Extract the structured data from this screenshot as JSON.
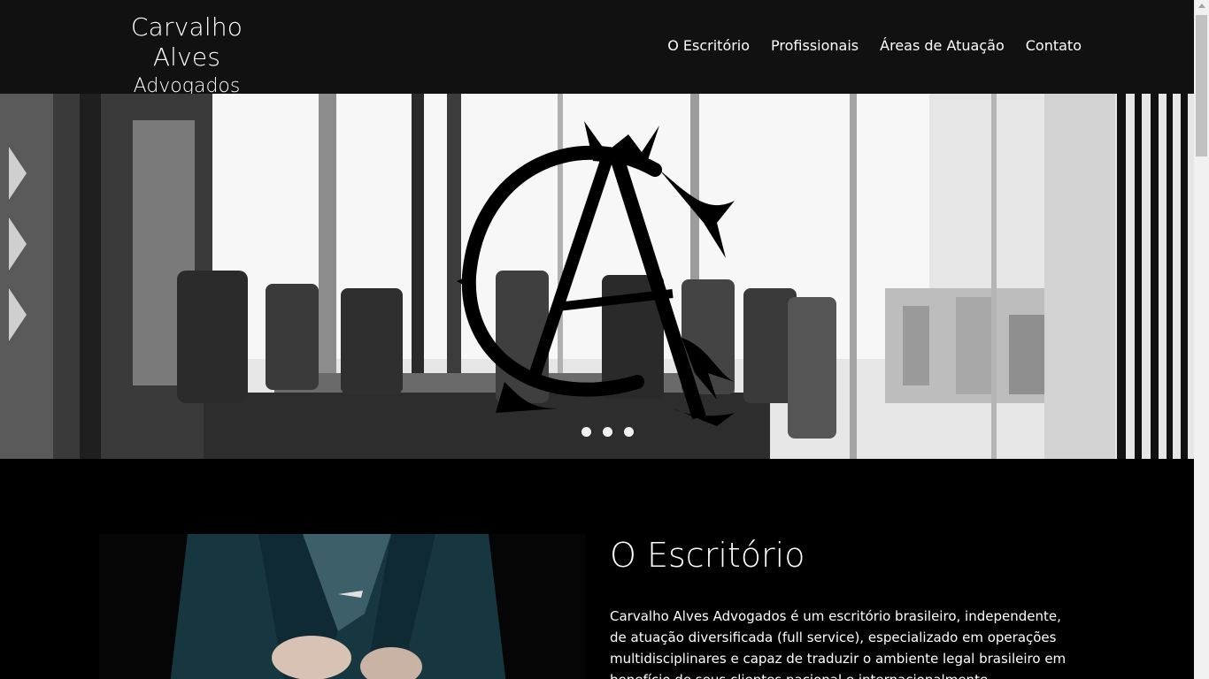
{
  "header": {
    "logo_line1": "Carvalho Alves",
    "logo_line2": "Advogados",
    "nav": [
      {
        "label": "O Escritório"
      },
      {
        "label": "Profissionais"
      },
      {
        "label": "Áreas de Atuação"
      },
      {
        "label": "Contato"
      }
    ]
  },
  "hero": {
    "monogram": "CA",
    "slides": 3,
    "active_slide": 1
  },
  "escritorio": {
    "title": "O Escritório",
    "text": "Carvalho Alves Advogados é um escritório brasileiro, independente, de atuação diversificada (full service), especializado em operações multidisciplinares e capaz de traduzir o ambiente legal brasileiro em benefício de seus clientes nacional e internacionalmente."
  },
  "colors": {
    "header_bg": "#111111",
    "page_bg": "#000000",
    "accent": "#ffffff"
  }
}
